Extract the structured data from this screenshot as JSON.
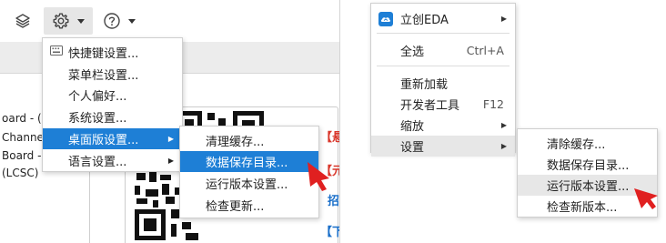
{
  "colors": {
    "accent": "#1e7fd6",
    "cursor": "#e02020",
    "red_text": "#d9372b",
    "link": "#1a6fc9"
  },
  "toolbar": {
    "layers_icon": "layers-icon",
    "settings_icon": "gear-icon",
    "help_icon": "help-icon",
    "dropdown_icon": "caret-down-icon"
  },
  "left_panel": {
    "side_texts": [
      "oard - (L",
      "Channe",
      "Board - (",
      "(LCSC)"
    ],
    "red_tags": [
      "【悬",
      "【元",
      "招",
      "【下"
    ]
  },
  "settings_menu": {
    "items": [
      {
        "label": "快捷键设置..."
      },
      {
        "label": "菜单栏设置..."
      },
      {
        "label": "个人偏好..."
      },
      {
        "label": "系统设置..."
      },
      {
        "label": "桌面版设置..."
      },
      {
        "label": "语言设置..."
      }
    ]
  },
  "desktop_submenu_left": {
    "items": [
      {
        "label": "清理缓存..."
      },
      {
        "label": "数据保存目录..."
      },
      {
        "label": "运行版本设置..."
      },
      {
        "label": "检查更新..."
      }
    ]
  },
  "context_menu": {
    "app_item": "立创EDA",
    "select_all": "全选",
    "select_all_shortcut": "Ctrl+A",
    "reload": "重新加载",
    "devtools": "开发者工具",
    "devtools_shortcut": "F12",
    "zoom": "缩放",
    "settings": "设置"
  },
  "settings_submenu_right": {
    "items": [
      {
        "label": "清除缓存..."
      },
      {
        "label": "数据保存目录..."
      },
      {
        "label": "运行版本设置..."
      },
      {
        "label": "检查新版本..."
      }
    ]
  }
}
